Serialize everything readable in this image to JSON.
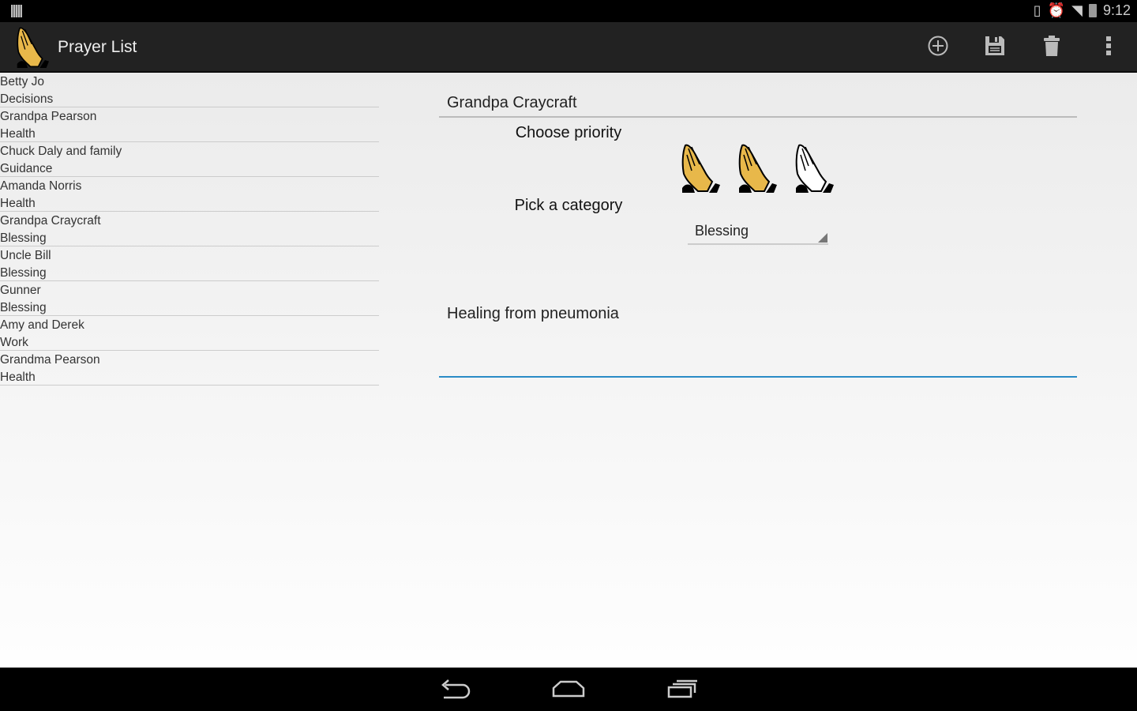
{
  "status_bar": {
    "time": "9:12",
    "icons": [
      "rotation-icon",
      "alarm-icon",
      "wifi-icon",
      "battery-charging-icon"
    ]
  },
  "app_bar": {
    "title": "Prayer List",
    "actions": [
      "add-icon",
      "save-icon",
      "delete-icon",
      "overflow-menu-icon"
    ]
  },
  "list": [
    {
      "name": "Betty Jo",
      "category": "Decisions"
    },
    {
      "name": "Grandpa Pearson",
      "category": "Health"
    },
    {
      "name": "Chuck Daly and family",
      "category": "Guidance"
    },
    {
      "name": "Amanda Norris",
      "category": "Health"
    },
    {
      "name": "Grandpa Craycraft",
      "category": "Blessing"
    },
    {
      "name": "Uncle Bill",
      "category": "Blessing"
    },
    {
      "name": "Gunner",
      "category": "Blessing"
    },
    {
      "name": "Amy and Derek",
      "category": "Work"
    },
    {
      "name": "Grandma Pearson",
      "category": "Health"
    }
  ],
  "detail": {
    "name": "Grandpa Craycraft",
    "priority_label": "Choose priority",
    "priority": {
      "value": 2,
      "max": 3
    },
    "category_label": "Pick a category",
    "category": "Blessing",
    "notes": "Healing from pneumonia"
  },
  "colors": {
    "accent": "#2a8bc6",
    "hands_fill": "#e8b84a",
    "app_bar": "#222222"
  }
}
